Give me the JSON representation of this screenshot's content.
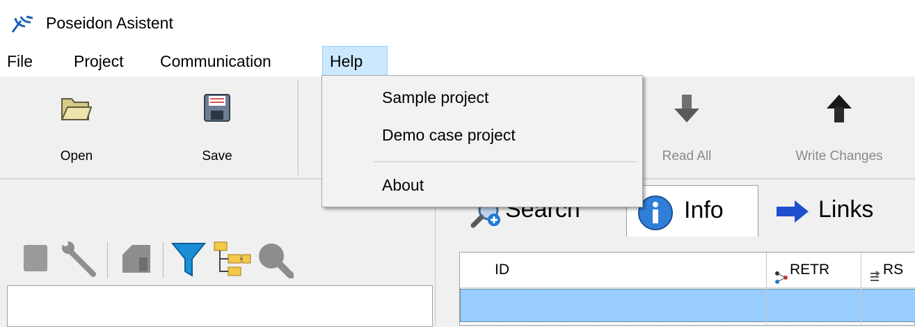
{
  "window": {
    "title": "Poseidon Asistent",
    "icon": "trident-icon"
  },
  "menubar": {
    "items": [
      {
        "label": "File"
      },
      {
        "label": "Project"
      },
      {
        "label": "Communication"
      },
      {
        "label": "Help",
        "active": true
      }
    ]
  },
  "toolbar": {
    "open_label": "Open",
    "save_label": "Save",
    "read_all_label": "Read All",
    "write_changes_label": "Write Changes"
  },
  "help_menu": {
    "items": [
      {
        "label": "Sample project"
      },
      {
        "label": "Demo case project"
      },
      {
        "label": "About"
      }
    ]
  },
  "tabs": {
    "search_label": "Search",
    "info_label": "Info",
    "links_label": "Links"
  },
  "grid": {
    "columns": [
      "ID",
      "RETR",
      "RS"
    ]
  },
  "colors": {
    "menu_highlight": "#cce8ff",
    "selected_row": "#99ccff"
  }
}
